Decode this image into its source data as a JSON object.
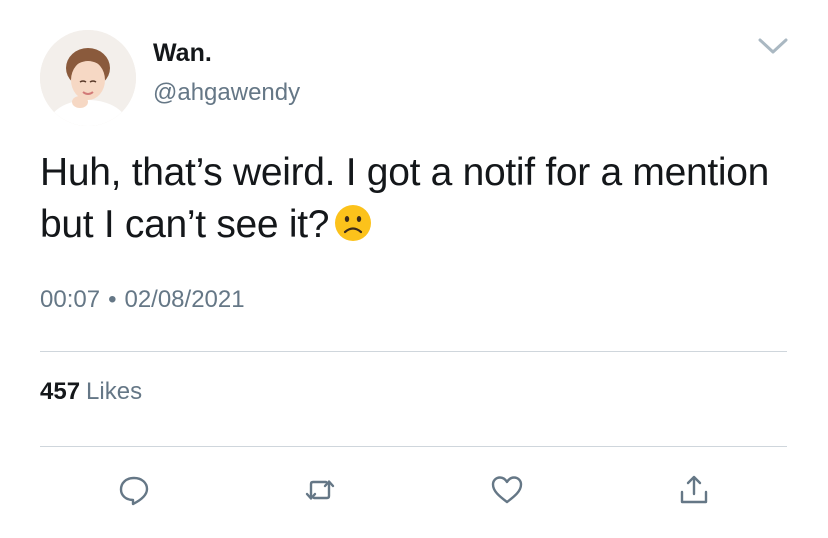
{
  "author": {
    "display_name": "Wan.",
    "handle": "@ahgawendy"
  },
  "tweet": {
    "text": "Huh, that’s weird. I got a notif for a mention but I can’t see it?",
    "emoji": "frowning-face",
    "time": "00:07",
    "separator": "•",
    "date": "02/08/2021"
  },
  "stats": {
    "likes_count": "457",
    "likes_label": "Likes"
  },
  "actions": [
    "reply-icon",
    "retweet-icon",
    "like-icon",
    "share-icon"
  ],
  "colors": {
    "text": "#14171a",
    "secondary": "#657786",
    "divider": "#cfd6dc",
    "emoji_face": "#fcc21b"
  }
}
